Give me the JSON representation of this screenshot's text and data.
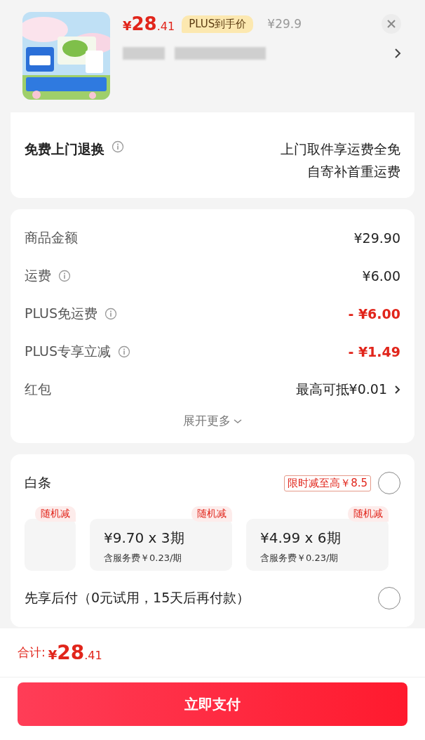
{
  "product": {
    "price": {
      "symbol": "¥",
      "integer": "28",
      "decimal": ".41"
    },
    "price_tag": "PLUS到手价",
    "original_price": "¥29.9"
  },
  "return_card": {
    "rows": [
      {
        "label": "免费上门退换",
        "info": true,
        "values": [
          "上门取件享运费全免",
          "自寄补首重运费"
        ]
      }
    ]
  },
  "cost_card": {
    "rows": [
      {
        "label": "商品金额",
        "info": false,
        "value": "¥29.90",
        "discount": false,
        "chevron": false
      },
      {
        "label": "运费",
        "info": true,
        "value": "¥6.00",
        "discount": false,
        "chevron": false
      },
      {
        "label": "PLUS免运费",
        "info": true,
        "value": "- ¥6.00",
        "discount": true,
        "chevron": false
      },
      {
        "label": "PLUS专享立减",
        "info": true,
        "value": "- ¥1.49",
        "discount": true,
        "chevron": false
      },
      {
        "label": "红包",
        "info": false,
        "value": "最高可抵¥0.01",
        "discount": false,
        "chevron": true
      }
    ],
    "expand": "展开更多"
  },
  "payment_card": {
    "methods": [
      {
        "label": "白条",
        "promo": "限时减至高￥8.5",
        "selected": false,
        "plans": [
          {
            "badge": "随机减"
          },
          {
            "badge": "随机减",
            "amount": "¥9.70 x 3期",
            "fee": "含服务费￥0.23/期"
          },
          {
            "badge": "随机减",
            "amount": "¥4.99 x 6期",
            "fee": "含服务费￥0.23/期"
          }
        ]
      },
      {
        "label": "先享后付（0元试用，15天后再付款）",
        "selected": false
      }
    ]
  },
  "footer": {
    "total_label": "合计:",
    "total": {
      "symbol": "¥",
      "integer": "28",
      "decimal": ".41"
    },
    "pay_button": "立即支付"
  }
}
